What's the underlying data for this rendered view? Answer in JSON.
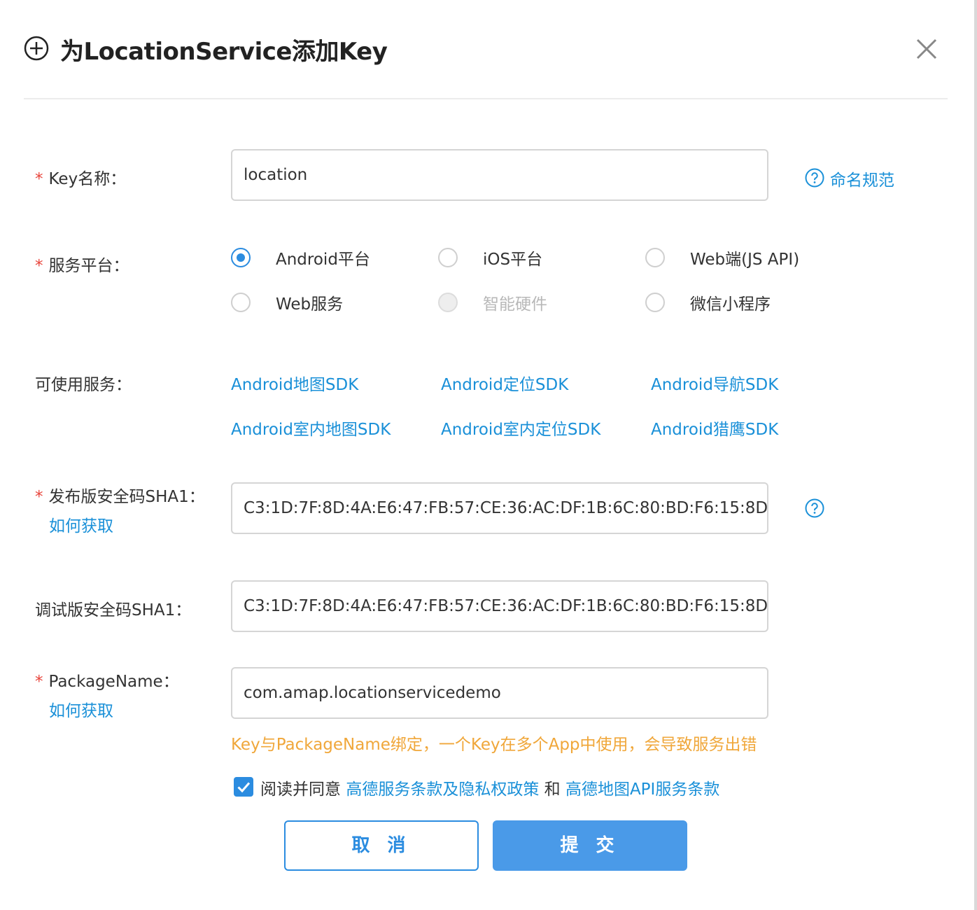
{
  "dialog": {
    "title": "为LocationService添加Key"
  },
  "form": {
    "required_mark": "*",
    "key_name": {
      "label": "Key名称：",
      "value": "location",
      "help_link": "命名规范"
    },
    "platform": {
      "label": "服务平台：",
      "options": [
        {
          "label": "Android平台",
          "state": "checked"
        },
        {
          "label": "iOS平台",
          "state": "unchecked"
        },
        {
          "label": "Web端(JS API)",
          "state": "unchecked"
        },
        {
          "label": "Web服务",
          "state": "unchecked"
        },
        {
          "label": "智能硬件",
          "state": "disabled"
        },
        {
          "label": "微信小程序",
          "state": "unchecked"
        }
      ]
    },
    "services": {
      "label": "可使用服务：",
      "items": [
        "Android地图SDK",
        "Android定位SDK",
        "Android导航SDK",
        "Android室内地图SDK",
        "Android室内定位SDK",
        "Android猎鹰SDK"
      ]
    },
    "release_sha1": {
      "label": "发布版安全码SHA1：",
      "how_link": "如何获取",
      "value": "C3:1D:7F:8D:4A:E6:47:FB:57:CE:36:AC:DF:1B:6C:80:BD:F6:15:8D"
    },
    "debug_sha1": {
      "label": "调试版安全码SHA1：",
      "value": "C3:1D:7F:8D:4A:E6:47:FB:57:CE:36:AC:DF:1B:6C:80:BD:F6:15:8D"
    },
    "package_name": {
      "label": "PackageName：",
      "how_link": "如何获取",
      "value": "com.amap.locationservicedemo",
      "warning": "Key与PackageName绑定，一个Key在多个App中使用，会导致服务出错"
    },
    "agreement": {
      "checked": true,
      "prefix": "阅读并同意 ",
      "link1": "高德服务条款及隐私权政策",
      "middle": " 和 ",
      "link2": "高德地图API服务条款"
    }
  },
  "buttons": {
    "cancel": "取 消",
    "submit": "提 交"
  },
  "colors": {
    "accent": "#2b8ce0",
    "link": "#1a90d8",
    "required": "#e8443b",
    "warning": "#f0a73a",
    "submit_bg": "#4a9ae8"
  }
}
